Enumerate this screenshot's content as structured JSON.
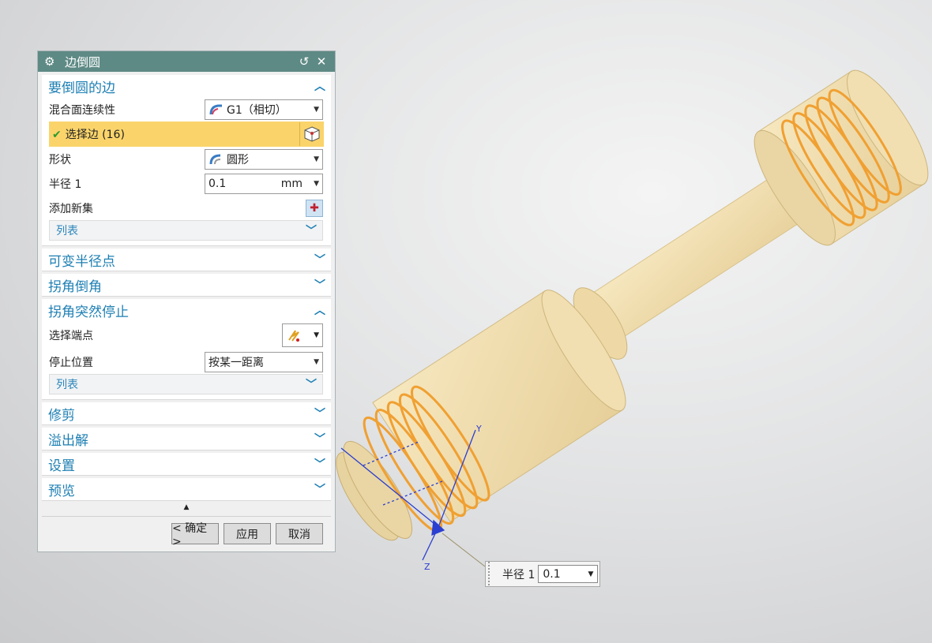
{
  "dialog": {
    "title": "边倒圆",
    "edges_section": {
      "title": "要倒圆的边",
      "continuity_label": "混合面连续性",
      "continuity_value": "G1（相切）",
      "select_edges_label": "选择边 (16)",
      "shape_label": "形状",
      "shape_value": "圆形",
      "radius_label": "半径 1",
      "radius_value": "0.1",
      "radius_unit": "mm",
      "add_set_label": "添加新集",
      "list_label": "列表"
    },
    "variable_radius_title": "可变半径点",
    "corner_setback_title": "拐角倒角",
    "stop_short_section": {
      "title": "拐角突然停止",
      "select_endpoint_label": "选择端点",
      "stop_position_label": "停止位置",
      "stop_position_value": "按某一距离",
      "list_label": "列表"
    },
    "trim_title": "修剪",
    "overflow_title": "溢出解",
    "settings_title": "设置",
    "preview_title": "预览",
    "buttons": {
      "ok": "< 确定 >",
      "apply": "应用",
      "cancel": "取消"
    }
  },
  "float_input": {
    "label": "半径 1",
    "value": "0.1"
  },
  "axes": {
    "y": "Y",
    "z": "Z"
  },
  "colors": {
    "title_bar": "#5e8a85",
    "section_text": "#1d7fb3",
    "selection_highlight": "#fad46b",
    "part_fill": "#f0dba9",
    "edge_highlight": "#f0a032"
  }
}
